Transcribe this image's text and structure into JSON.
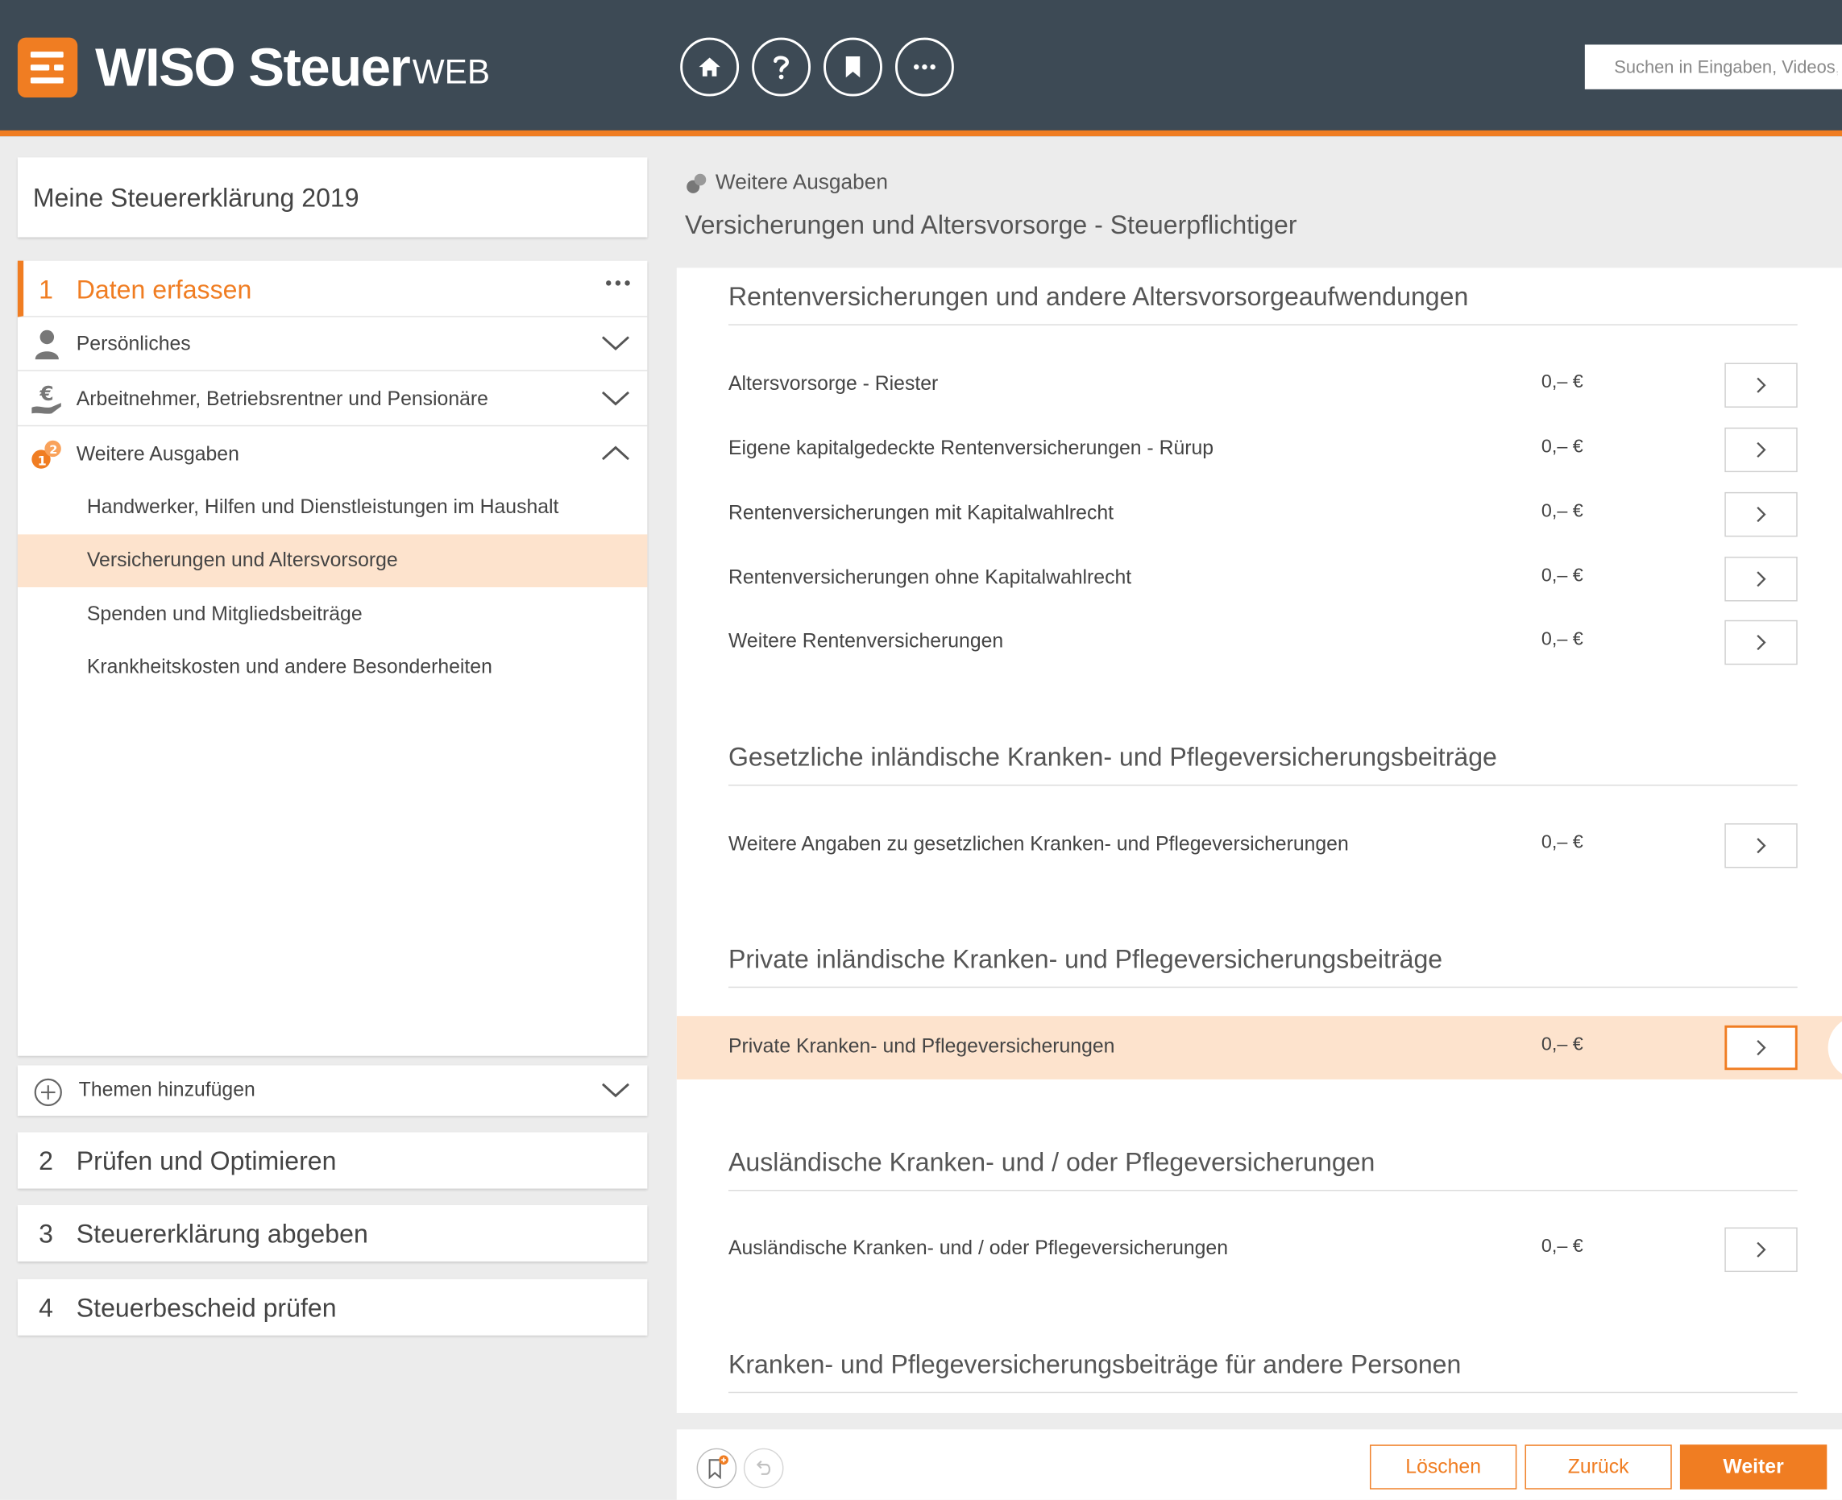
{
  "header": {
    "brand": "WISO Steuer",
    "brand_suffix": "WEB",
    "search_placeholder": "Suchen in Eingaben, Videos, Hilfe ..."
  },
  "sidebar": {
    "year_title": "Meine Steuererklärung 2019",
    "active_step": {
      "number": "1",
      "label": "Daten erfassen"
    },
    "sections": [
      {
        "label": "Persönliches",
        "icon": "person-icon",
        "expanded": false
      },
      {
        "label": "Arbeitnehmer, Betriebsrentner und Pensionäre",
        "icon": "euro-hand-icon",
        "expanded": false
      },
      {
        "label": "Weitere Ausgaben",
        "icon": "coins-icon",
        "expanded": true
      }
    ],
    "subitems": [
      {
        "label": "Handwerker, Hilfen und Dienstleistungen im Haushalt",
        "active": false
      },
      {
        "label": "Versicherungen und Altersvorsorge",
        "active": true
      },
      {
        "label": "Spenden und Mitgliedsbeiträge",
        "active": false
      },
      {
        "label": "Krankheitskosten und andere Besonderheiten",
        "active": false
      }
    ],
    "add_topics": "Themen hinzufügen",
    "steps": [
      {
        "number": "2",
        "label": "Prüfen und Optimieren"
      },
      {
        "number": "3",
        "label": "Steuererklärung abgeben"
      },
      {
        "number": "4",
        "label": "Steuerbescheid prüfen"
      }
    ]
  },
  "main": {
    "breadcrumb": "Weitere Ausgaben",
    "title": "Versicherungen und Altersvorsorge - Steuerpflichtiger",
    "sections": [
      {
        "title": "Rentenversicherungen und andere Altersvorsorgeaufwendungen",
        "rows": [
          {
            "label": "Altersvorsorge - Riester",
            "value": "0,– €"
          },
          {
            "label": "Eigene kapitalgedeckte Rentenversicherungen - Rürup",
            "value": "0,– €"
          },
          {
            "label": "Rentenversicherungen mit Kapitalwahlrecht",
            "value": "0,– €"
          },
          {
            "label": "Rentenversicherungen ohne Kapitalwahlrecht",
            "value": "0,– €"
          },
          {
            "label": "Weitere Rentenversicherungen",
            "value": "0,– €"
          }
        ]
      },
      {
        "title": "Gesetzliche inländische Kranken- und Pflegeversicherungsbeiträge",
        "rows": [
          {
            "label": "Weitere Angaben zu gesetzlichen Kranken- und Pflegeversicherungen",
            "value": "0,– €"
          }
        ]
      },
      {
        "title": "Private inländische Kranken- und Pflegeversicherungsbeiträge",
        "rows": [
          {
            "label": "Private Kranken- und Pflegeversicherungen",
            "value": "0,– €",
            "highlighted": true
          }
        ]
      },
      {
        "title": "Ausländische Kranken- und / oder Pflegeversicherungen",
        "rows": [
          {
            "label": "Ausländische Kranken- und / oder Pflegeversicherungen",
            "value": "0,– €"
          }
        ]
      },
      {
        "title": "Kranken- und Pflegeversicherungsbeiträge für andere Personen",
        "rows": []
      }
    ]
  },
  "footer": {
    "delete_label": "Löschen",
    "back_label": "Zurück",
    "next_label": "Weiter"
  },
  "colors": {
    "accent": "#f07d22",
    "header_bg": "#3d4a55",
    "highlight": "#fde3cd"
  }
}
